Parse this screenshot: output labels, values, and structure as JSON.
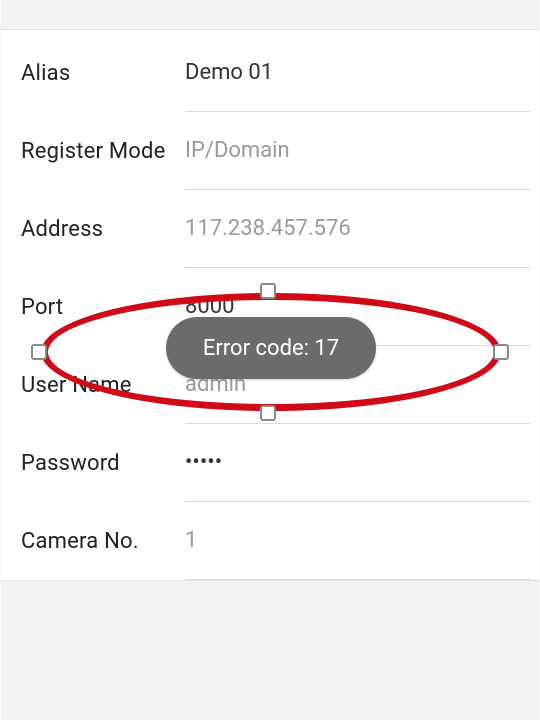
{
  "fields": {
    "alias": {
      "label": "Alias",
      "value": "Demo 01",
      "muted": false
    },
    "registerMode": {
      "label": "Register Mode",
      "value": "IP/Domain",
      "muted": true
    },
    "address": {
      "label": "Address",
      "value": "117.238.457.576",
      "muted": true
    },
    "port": {
      "label": "Port",
      "value": "8000",
      "muted": false
    },
    "userName": {
      "label": "User Name",
      "value": "admin",
      "muted": true
    },
    "password": {
      "label": "Password",
      "value": "•••••",
      "muted": false
    },
    "cameraNo": {
      "label": "Camera No.",
      "value": "1",
      "muted": true
    }
  },
  "toast": {
    "message": "Error code: 17"
  },
  "annotation": {
    "color": "#d10a17"
  }
}
